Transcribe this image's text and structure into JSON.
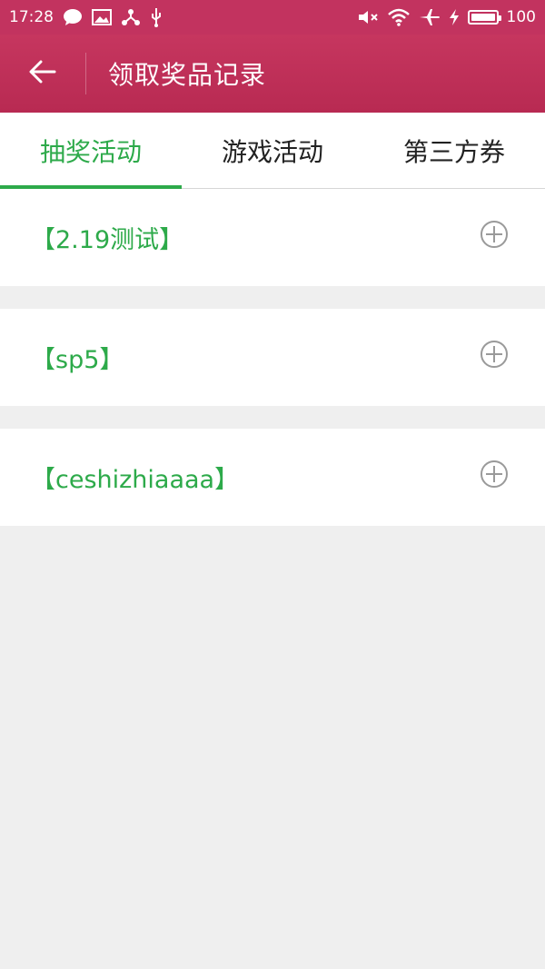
{
  "status_bar": {
    "time": "17:28",
    "battery": "100",
    "icons": [
      "chat-icon",
      "image-icon",
      "share-icon",
      "usb-icon",
      "mute-icon",
      "wifi-icon",
      "airplane-icon",
      "charging-icon",
      "battery-icon"
    ]
  },
  "header": {
    "title": "领取奖品记录",
    "back_icon": "arrow-left-icon"
  },
  "tabs": [
    {
      "label": "抽奖活动",
      "active": true
    },
    {
      "label": "游戏活动",
      "active": false
    },
    {
      "label": "第三方券",
      "active": false
    }
  ],
  "list": {
    "items": [
      {
        "title": "【2.19测试】",
        "icon": "plus-circle-icon"
      },
      {
        "title": "【sp5】",
        "icon": "plus-circle-icon"
      },
      {
        "title": "【ceshizhiaaaa】",
        "icon": "plus-circle-icon"
      }
    ]
  },
  "colors": {
    "header_bg": "#c2335f",
    "accent_green": "#2daa4a",
    "page_bg": "#efefef"
  }
}
